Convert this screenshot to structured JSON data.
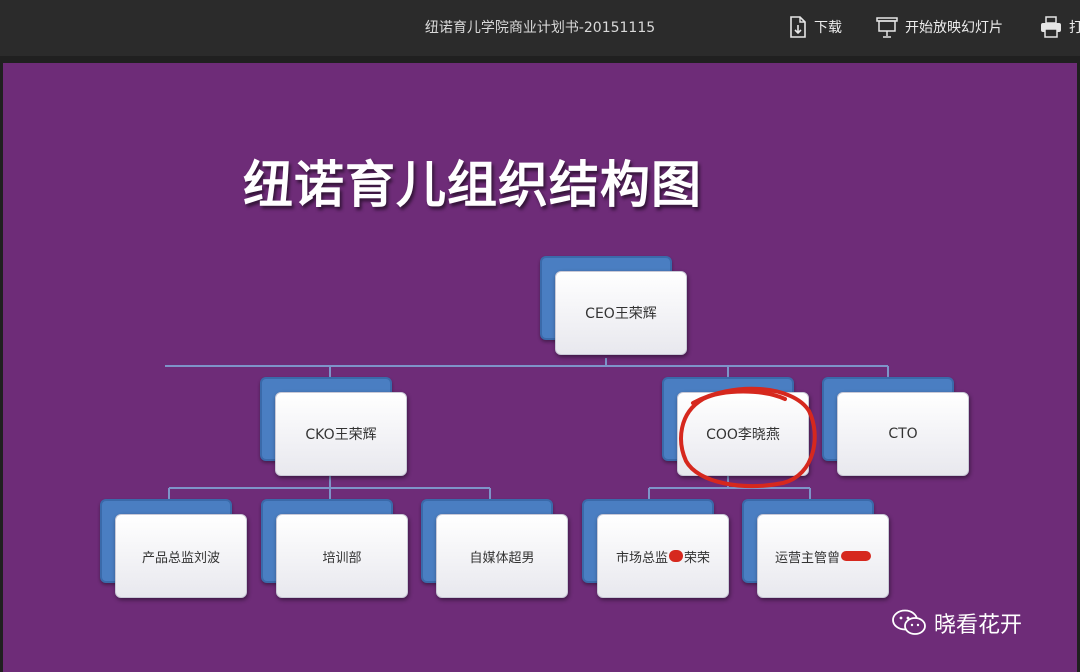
{
  "toolbar": {
    "doc_title": "纽诺育儿学院商业计划书-20151115",
    "download_label": "下载",
    "slideshow_label": "开始放映幻灯片",
    "print_label": "打"
  },
  "slide": {
    "title": "纽诺育儿组织结构图",
    "org_chart": {
      "ceo": "CEO王荣辉",
      "cko": "CKO王荣辉",
      "coo": "COO李晓燕",
      "cto": "CTO",
      "product": "产品总监刘波",
      "training": "培训部",
      "media": "自媒体超男",
      "marketing": "市场总监",
      "marketing_suffix": "荣荣",
      "operations": "运营主管曾"
    },
    "annotation_color": "#d6281e",
    "slide_bg": "#6e2c78"
  },
  "watermark": {
    "text": "晓看花开",
    "icon": "wechat-icon"
  }
}
